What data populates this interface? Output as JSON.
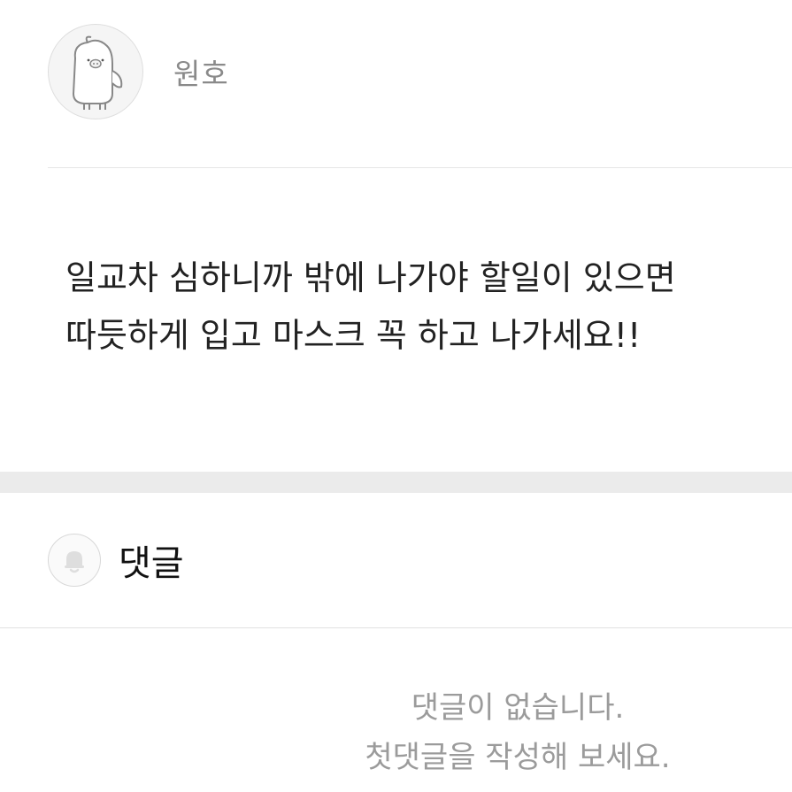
{
  "author": {
    "avatar_icon": "pig-character-avatar-icon",
    "name": "원호"
  },
  "post": {
    "lines": [
      "일교차 심하니까 밖에 나가야 할일이 있으면",
      "따듯하게 입고 마스크 꼭 하고 나가세요!!"
    ]
  },
  "comments": {
    "icon": "bell-icon",
    "title": "댓글",
    "empty_line1": "댓글이 없습니다.",
    "empty_line2": "첫댓글을 작성해 보세요."
  },
  "colors": {
    "text_primary": "#222222",
    "text_muted": "#9b9b9b",
    "section_gap": "#ebebeb"
  }
}
